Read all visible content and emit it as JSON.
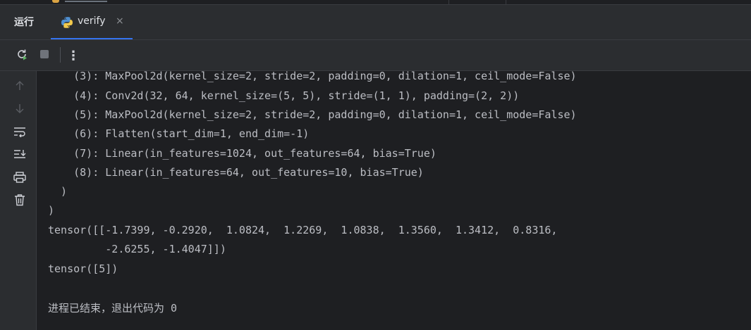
{
  "tabbar": {
    "run_title": "运行",
    "tab": {
      "label": "verify",
      "close": "×"
    }
  },
  "toolbar": {
    "rerun": "rerun-icon",
    "stop": "stop-icon",
    "more": "⋮"
  },
  "sidebar": {
    "items": [
      "up-arrow-icon",
      "down-arrow-icon",
      "soft-wrap-icon",
      "scroll-to-end-icon",
      "print-icon",
      "trash-icon"
    ]
  },
  "console": {
    "lines": [
      "    (3): MaxPool2d(kernel_size=2, stride=2, padding=0, dilation=1, ceil_mode=False)",
      "    (4): Conv2d(32, 64, kernel_size=(5, 5), stride=(1, 1), padding=(2, 2))",
      "    (5): MaxPool2d(kernel_size=2, stride=2, padding=0, dilation=1, ceil_mode=False)",
      "    (6): Flatten(start_dim=1, end_dim=-1)",
      "    (7): Linear(in_features=1024, out_features=64, bias=True)",
      "    (8): Linear(in_features=64, out_features=10, bias=True)",
      "  )",
      ")",
      "tensor([[-1.7399, -0.2920,  1.0824,  1.2269,  1.0838,  1.3560,  1.3412,  0.8316,",
      "         -2.6255, -1.4047]])",
      "tensor([5])",
      "",
      "进程已结束，退出代码为 0"
    ]
  }
}
